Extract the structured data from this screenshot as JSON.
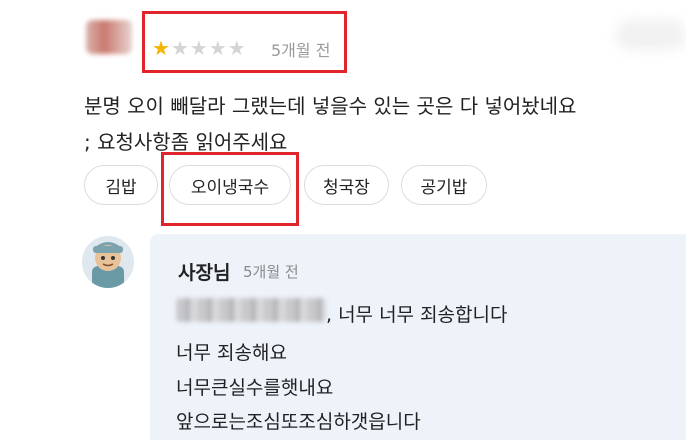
{
  "review": {
    "rating": 1,
    "rating_max": 5,
    "date": "5개월 전",
    "text_line1": "분명 오이 빼달라 그랬는데 넣을수 있는 곳은 다 넣어놨네요",
    "text_line2": "; 요청사항좀 읽어주세요"
  },
  "menu_tags": [
    "김밥",
    "오이냉국수",
    "청국장",
    "공기밥"
  ],
  "owner_reply": {
    "name": "사장님",
    "date": "5개월 전",
    "line1_suffix": ", 너무 너무 죄송합니다",
    "line2": "너무 죄송해요",
    "line3": "너무큰실수를햇내요",
    "line4": "앞으로는조심또조심하갯읍니다"
  },
  "colors": {
    "highlight_box": "#e0262c",
    "star_filled": "#f5b400",
    "star_empty": "#d5d5d5",
    "reply_background": "#eef3fa"
  }
}
